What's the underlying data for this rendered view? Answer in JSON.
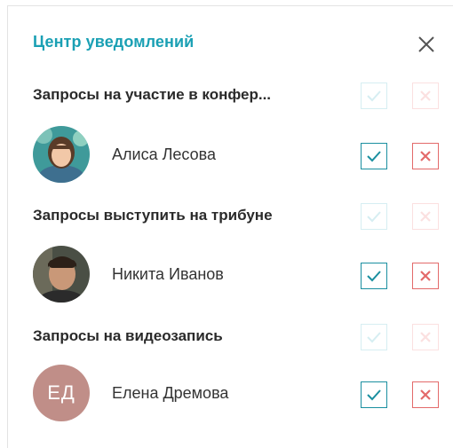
{
  "panel": {
    "title": "Центр уведомлений",
    "close_icon": "close-icon"
  },
  "sections": [
    {
      "title": "Запросы на участие в конфер...",
      "person": {
        "name": "Алиса Лесова",
        "avatar": "photo"
      }
    },
    {
      "title": "Запросы выступить на трибуне",
      "person": {
        "name": "Никита Иванов",
        "avatar": "photo"
      }
    },
    {
      "title": "Запросы на видеозапись",
      "person": {
        "name": "Елена Дремова",
        "initials": "ЕД",
        "avatar_color": "#c08e88"
      }
    }
  ],
  "colors": {
    "accent": "#1aa0b4",
    "accept": "#1a8fa0",
    "reject": "#e36a6a"
  }
}
